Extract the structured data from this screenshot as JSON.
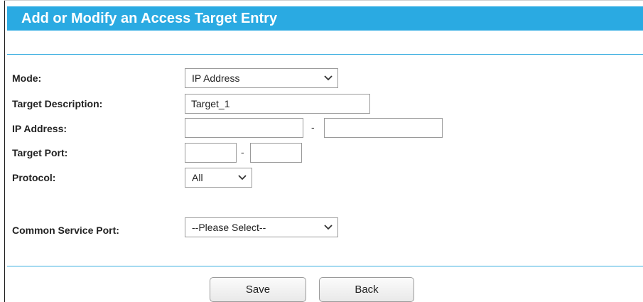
{
  "header": {
    "title": "Add or Modify an Access Target Entry"
  },
  "colors": {
    "header_bg": "#2aaae2",
    "divider": "#3aaee0"
  },
  "form": {
    "mode_label": "Mode:",
    "mode_value": "IP Address",
    "description_label": "Target Description:",
    "description_value": "Target_1",
    "ip_label": "IP Address:",
    "ip_start_value": "",
    "ip_end_value": "",
    "ip_separator": "-",
    "port_label": "Target Port:",
    "port_start_value": "",
    "port_end_value": "",
    "port_separator": "-",
    "protocol_label": "Protocol:",
    "protocol_value": "All",
    "service_label": "Common Service Port:",
    "service_value": "--Please Select--"
  },
  "icons": {
    "dropdown": "chevron-down-icon"
  },
  "buttons": {
    "save_label": "Save",
    "back_label": "Back"
  }
}
